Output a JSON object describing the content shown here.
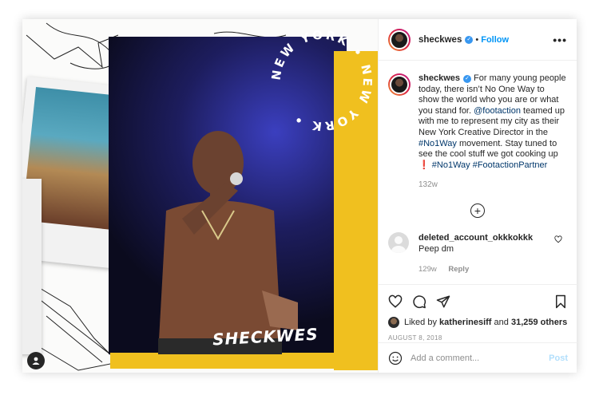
{
  "photo": {
    "brand_text": "SHECKWES",
    "ring_text": "NEW YORK • NEW YORK • "
  },
  "header": {
    "username": "sheckwes",
    "separator": "•",
    "follow_label": "Follow",
    "more_label": "•••"
  },
  "caption": {
    "username": "sheckwes",
    "text_1": " For many young people today, there isn’t No One Way to show the world who you are or what you stand for. ",
    "mention": "@footaction",
    "text_2": " teamed up with me to represent my city as their New York Creative Director in the ",
    "hashtag_1": "#No1Way",
    "text_3": " movement. Stay tuned to see the cool stuff we got cooking up ",
    "emoji": "❗",
    "hashtag_2": "#No1Way",
    "hashtag_3": "#FootactionPartner",
    "age": "132w"
  },
  "load_more_label": "+",
  "comments": [
    {
      "username": "deleted_account_okkkokkk",
      "text": " Peep dm",
      "age": "129w",
      "reply_label": "Reply"
    }
  ],
  "likes": {
    "prefix": "Liked by ",
    "user": "katherinesiff",
    "middle": " and ",
    "count": "31,259 others"
  },
  "date": "AUGUST 8, 2018",
  "comment_box": {
    "placeholder": "Add a comment...",
    "post_label": "Post"
  },
  "colors": {
    "accent": "#0095f6",
    "yellow": "#f0c01f",
    "verified": "#3897f0"
  }
}
